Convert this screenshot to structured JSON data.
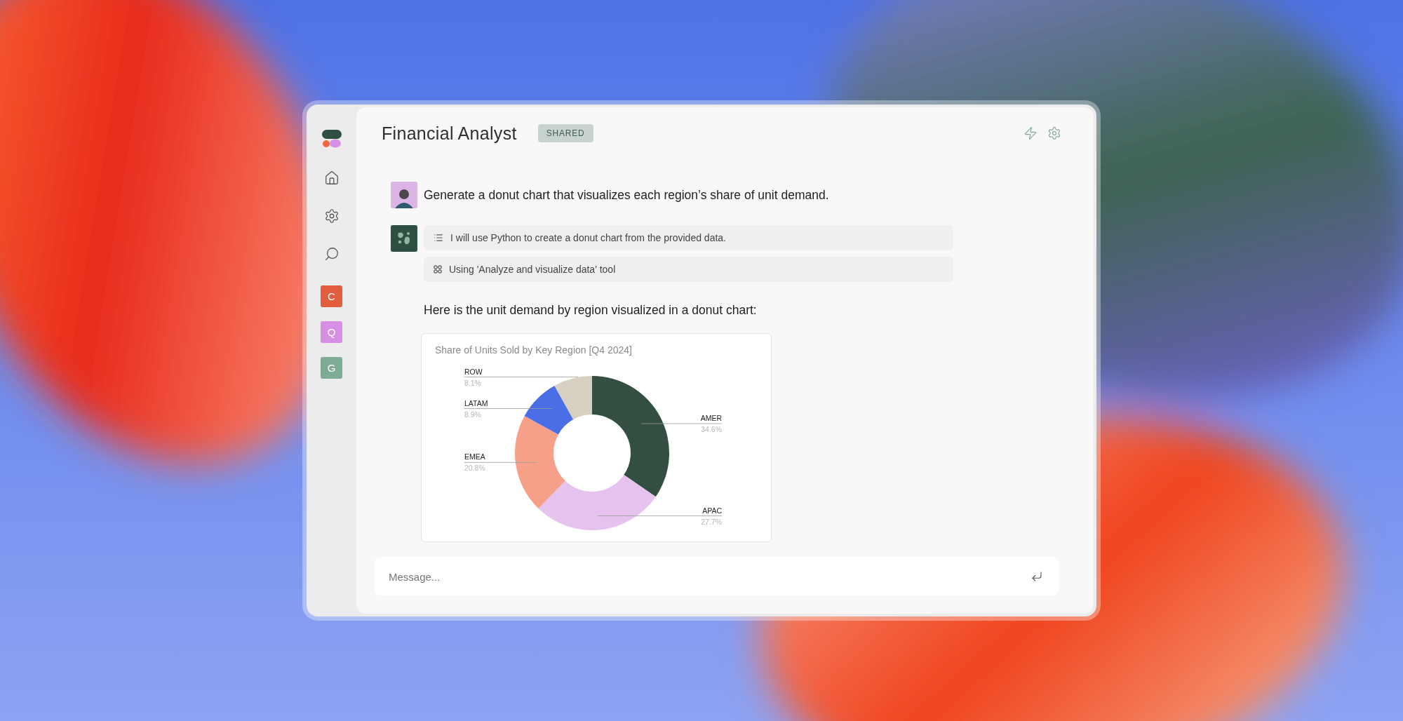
{
  "sidebar": {
    "workspaces": [
      {
        "label": "C",
        "color": "#e35d3f"
      },
      {
        "label": "Q",
        "color": "#d78fe3"
      },
      {
        "label": "G",
        "color": "#7dab96"
      }
    ]
  },
  "header": {
    "title": "Financial Analyst",
    "badge": "SHARED"
  },
  "messages": [
    {
      "kind": "user",
      "text": "Generate a donut chart that visualizes each region’s share of unit demand."
    },
    {
      "kind": "assistant",
      "steps": [
        {
          "kind": "plan",
          "text": "I will use Python to create a donut chart from the provided data."
        },
        {
          "kind": "tool",
          "text": "Using 'Analyze and visualize data' tool"
        }
      ],
      "text": "Here is the unit demand by region visualized in a donut chart:",
      "chart_data": {
        "type": "donut",
        "title": "Share of Units Sold by Key Region [Q4 2024]",
        "categories": [
          "AMER",
          "APAC",
          "EMEA",
          "LATAM",
          "ROW"
        ],
        "values": [
          34.6,
          27.7,
          20.8,
          8.9,
          8.1
        ],
        "value_labels": [
          "34.6%",
          "27.7%",
          "20.8%",
          "8.9%",
          "8.1%"
        ]
      }
    }
  ],
  "composer": {
    "placeholder": "Message..."
  }
}
